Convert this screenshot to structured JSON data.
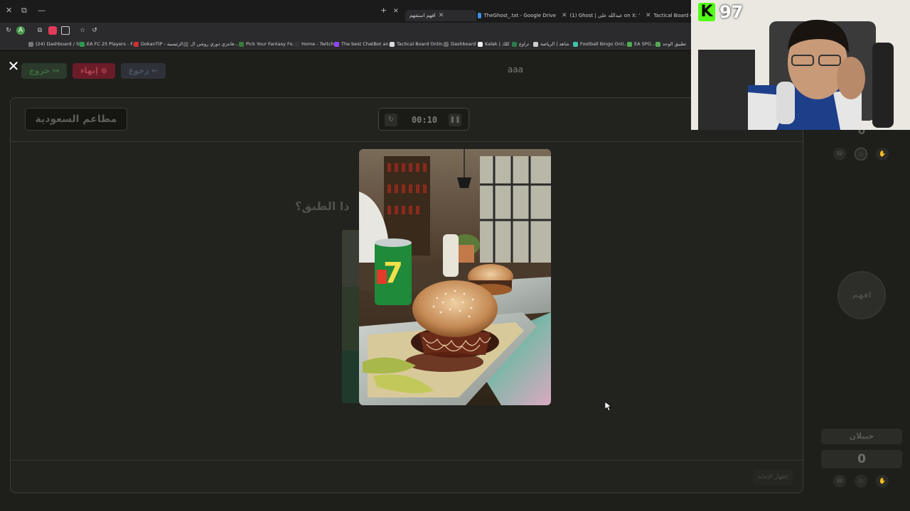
{
  "browser": {
    "tabs": [
      {
        "label": "افهم استفهم",
        "active": true
      },
      {
        "label": "TheGhost_.txt - Google Drive"
      },
      {
        "label": "(1) Ghost | عبدالله علي on X: \"تعليقات"
      },
      {
        "label": "Tactical Board Online"
      }
    ],
    "bookmarks": [
      "(24) Dashboard / Str...",
      "EA FC 25 Players - F...",
      "DokanTIP - الرئيسية",
      "فانتزي دوري روشن ال...",
      "Pick Your Fantasy Fo...",
      "Home - Twitch",
      "The best ChatBot an...",
      "Tactical Board Onlin...",
      "Dashboard",
      "Kalak | كلك",
      "تراوع",
      "شاهد | الرياضة",
      "Football Bingo Onli...",
      "EA SPO...",
      "تطبيق الوحد"
    ]
  },
  "app": {
    "top": {
      "exit_label": "خروج",
      "end_label": "إنهاء",
      "back_label": "رجوع",
      "room_code": "aaa"
    },
    "category": "مطاعم السعودية",
    "timer": {
      "value": "00:10",
      "reset_icon": "refresh-icon",
      "pause_icon": "pause-icon"
    },
    "question": "ما هذا الطبق؟",
    "question_visible": "ذا الطبق؟",
    "show_answer_label": "إظهار الإجابة",
    "team": {
      "score_top": "0",
      "logo_text": "افهم",
      "name": "خبيلان",
      "score": "0"
    }
  },
  "stream_overlay": {
    "platform_icon": "kick-logo",
    "viewer_count": "97"
  },
  "colors": {
    "accent_green": "#53fc18",
    "end_button": "#6a1c28",
    "board_bg": "#22231f"
  }
}
